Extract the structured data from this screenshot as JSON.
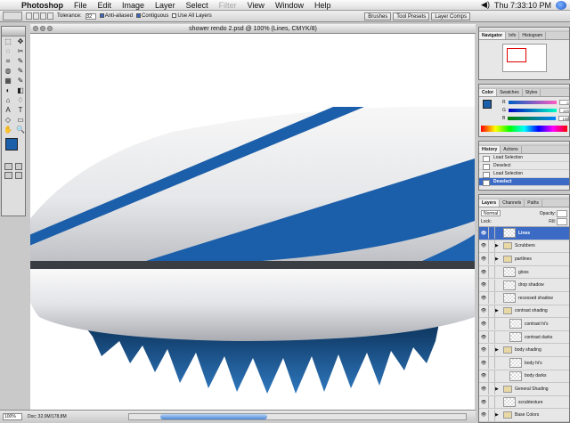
{
  "menubar": {
    "apple": "",
    "items": [
      {
        "label": "Photoshop",
        "app": true
      },
      {
        "label": "File"
      },
      {
        "label": "Edit"
      },
      {
        "label": "Image"
      },
      {
        "label": "Layer"
      },
      {
        "label": "Select"
      },
      {
        "label": "Filter",
        "disabled": true
      },
      {
        "label": "View"
      },
      {
        "label": "Window"
      },
      {
        "label": "Help"
      }
    ],
    "clock": "Thu 7:33:10 PM"
  },
  "options_bar": {
    "tolerance_label": "Tolerance:",
    "tolerance_value": "32",
    "anti_aliased": "Anti-aliased",
    "contiguous": "Contiguous",
    "use_all_layers": "Use All Layers",
    "well_tabs": [
      "Brushes",
      "Tool Presets",
      "Layer Comps"
    ]
  },
  "toolbox": {
    "tools": [
      "⬚",
      "✥",
      "◌",
      "✂",
      "⌗",
      "✎",
      "◍",
      "✎",
      "▦",
      "✎",
      "◐",
      "◧",
      "⌂",
      "♢",
      "A",
      "T",
      "◇",
      "▭",
      "✋",
      "🔍"
    ],
    "foreground_color": "#1b5ea9",
    "background_color": "#ffffff"
  },
  "document": {
    "title": "shower rendo 2.psd @ 100% (Lines, CMYK/8)",
    "zoom": "100%",
    "doc_info": "Doc: 32.0M/178.8M",
    "accent_color": "#1b5ea9"
  },
  "navigator": {
    "tabs": [
      "Navigator",
      "Info",
      "Histogram"
    ]
  },
  "color_palette": {
    "tabs": [
      "Color",
      "Swatches",
      "Styles"
    ],
    "channels": [
      {
        "label": "R",
        "value": "0"
      },
      {
        "label": "G",
        "value": "129"
      },
      {
        "label": "B",
        "value": "195"
      }
    ]
  },
  "history": {
    "tabs": [
      "History",
      "Actions"
    ],
    "items": [
      {
        "label": "Load Selection"
      },
      {
        "label": "Deselect"
      },
      {
        "label": "Load Selection"
      },
      {
        "label": "Deselect",
        "active": true
      }
    ]
  },
  "layers": {
    "tabs": [
      "Layers",
      "Channels",
      "Paths"
    ],
    "blend_mode": "Normal",
    "opacity_label": "Opacity:",
    "lock_label": "Lock:",
    "fill_label": "Fill:",
    "items": [
      {
        "name": "Lines",
        "active": true
      },
      {
        "name": "Scrubbers",
        "group": true
      },
      {
        "name": "partlines",
        "group": true
      },
      {
        "name": "gloss"
      },
      {
        "name": "drop shadow"
      },
      {
        "name": "recessed shadow"
      },
      {
        "name": "contrast shading",
        "group": true
      },
      {
        "name": "contrast hi's",
        "indent": true
      },
      {
        "name": "contrast darks",
        "indent": true
      },
      {
        "name": "body shading",
        "group": true
      },
      {
        "name": "body hi's",
        "indent": true
      },
      {
        "name": "body darks",
        "indent": true
      },
      {
        "name": "General Shading",
        "group": true
      },
      {
        "name": "scrubtexture"
      },
      {
        "name": "Base Colors",
        "group": true
      },
      {
        "name": "contrast Ba..."
      }
    ]
  }
}
